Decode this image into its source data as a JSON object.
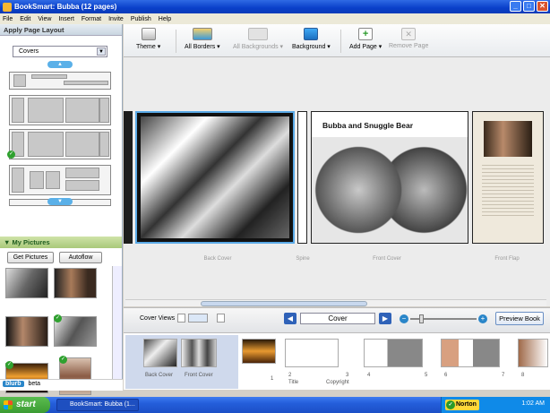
{
  "window": {
    "title": "BookSmart: Bubba (12 pages)",
    "buttons": [
      "_",
      "□",
      "✕"
    ]
  },
  "menu": [
    "File",
    "Edit",
    "View",
    "Insert",
    "Format",
    "Invite",
    "Publish",
    "Help"
  ],
  "left_panel": {
    "header": "Apply Page Layout",
    "layout_select": "Covers",
    "my_pictures_header": "My Pictures",
    "get_pictures_button": "Get Pictures",
    "autoflow_button": "Autoflow",
    "blurb_logo": "blurb",
    "blurb_tag": "beta"
  },
  "toolbar": {
    "theme": "Theme ▾",
    "all_borders": "All Borders ▾",
    "all_backgrounds": "All Backgrounds ▾",
    "background": "Background ▾",
    "add_page": "Add Page ▾",
    "remove_page": "Remove Page"
  },
  "canvas": {
    "book_title": "Bubba and Snuggle Bear",
    "captions": {
      "back_cover": "Back Cover",
      "spine": "Spine",
      "front_cover": "Front Cover",
      "front_flap": "Front Flap"
    }
  },
  "nav": {
    "cover_views_label": "Cover Views",
    "current_page": "Cover",
    "preview_button": "Preview Book"
  },
  "filmstrip": {
    "back_cover": "Back Cover",
    "front_cover": "Front Cover",
    "labels": [
      "1",
      "2",
      "Title",
      "3",
      "Copyright",
      "4",
      "5",
      "6",
      "7",
      "8"
    ]
  },
  "taskbar": {
    "start": "start",
    "task_item": "BookSmart: Bubba (1...",
    "norton": "Norton",
    "clock": "1:02 AM"
  },
  "colors": {
    "titlebar": "#0a3fc9",
    "accent_green": "#a9c97a",
    "canvas_bg": "#ececec"
  }
}
